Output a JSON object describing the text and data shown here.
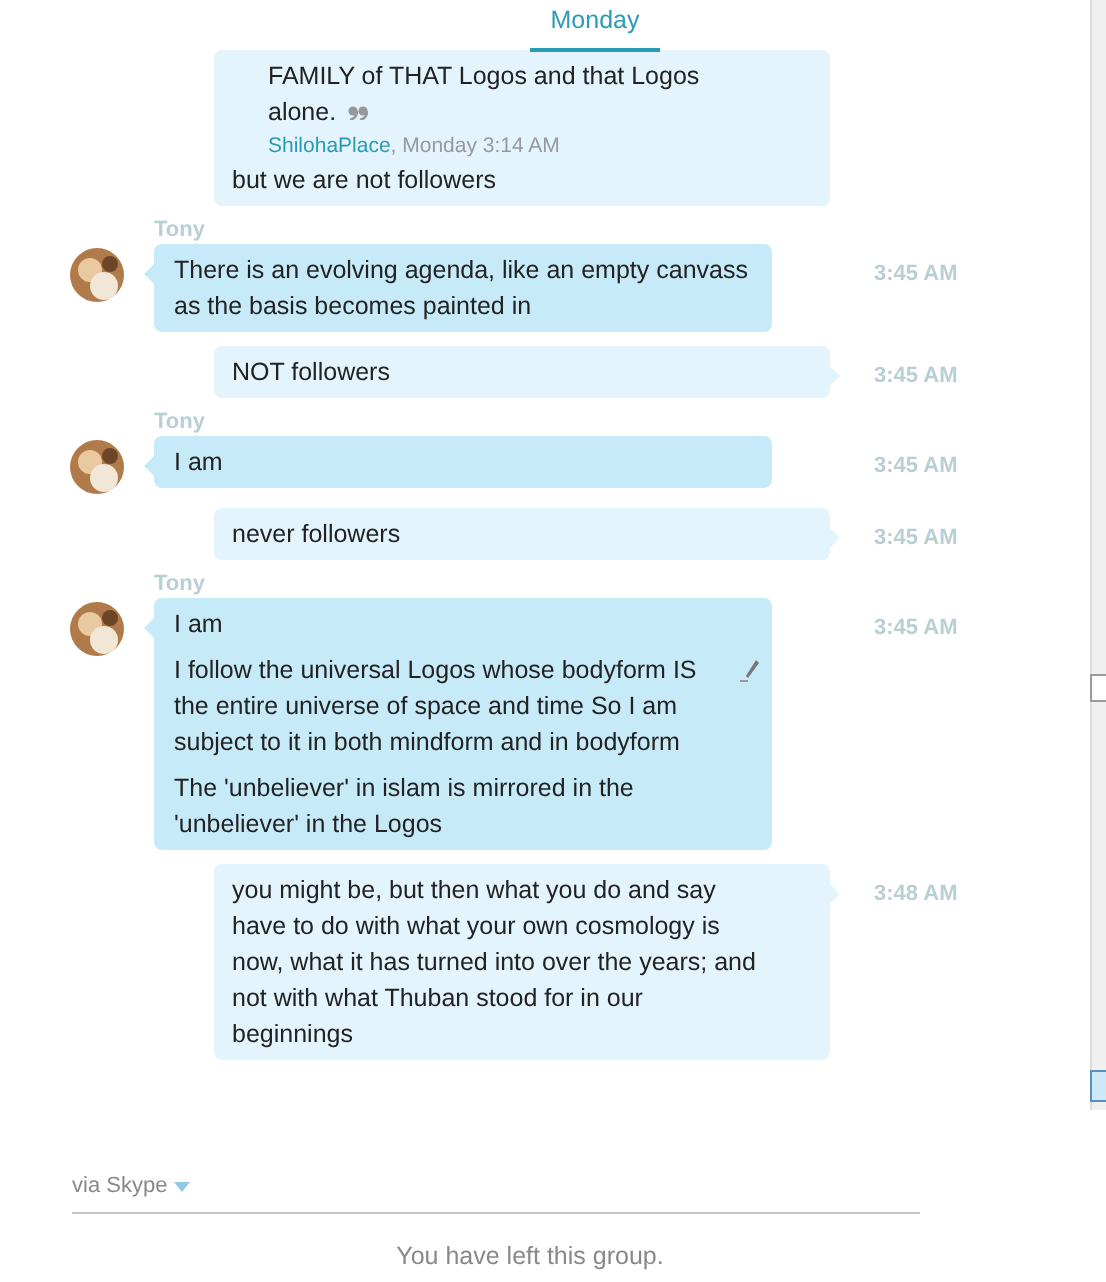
{
  "day_header": {
    "label": "Monday"
  },
  "messages": [
    {
      "kind": "own",
      "quote": {
        "lines": [
          "FAMILY of THAT Logos and that Logos",
          "alone."
        ],
        "author": "ShilohaPlace",
        "when": ", Monday 3:14 AM"
      },
      "paragraphs": [
        "but we are not followers"
      ]
    },
    {
      "kind": "contact",
      "sender": "Tony",
      "paragraphs": [
        "There is an evolving agenda, like an empty canvass as the basis becomes painted in"
      ],
      "time": "3:45 AM",
      "edited": false
    },
    {
      "kind": "own",
      "paragraphs": [
        "NOT followers"
      ],
      "time": "3:45 AM"
    },
    {
      "kind": "contact",
      "sender": "Tony",
      "paragraphs": [
        "I am"
      ],
      "time": "3:45 AM",
      "edited": false
    },
    {
      "kind": "own",
      "paragraphs": [
        "never followers"
      ],
      "time": "3:45 AM"
    },
    {
      "kind": "contact",
      "sender": "Tony",
      "paragraphs": [
        "I am",
        "I follow the universal Logos whose bodyform IS the entire universe of space and time So I am subject to it in both mindform and in bodyform",
        "The 'unbeliever' in islam is mirrored in the 'unbeliever' in the Logos"
      ],
      "time": "3:45 AM",
      "edited": true
    },
    {
      "kind": "own",
      "paragraphs": [
        "you might be, but then what you do and say have to do with what your own cosmology is now, what it has turned into over the years; and not with what Thuban stood for in our beginnings"
      ],
      "time": "3:48 AM"
    }
  ],
  "via": {
    "label": "via Skype"
  },
  "status": "You have left this group."
}
